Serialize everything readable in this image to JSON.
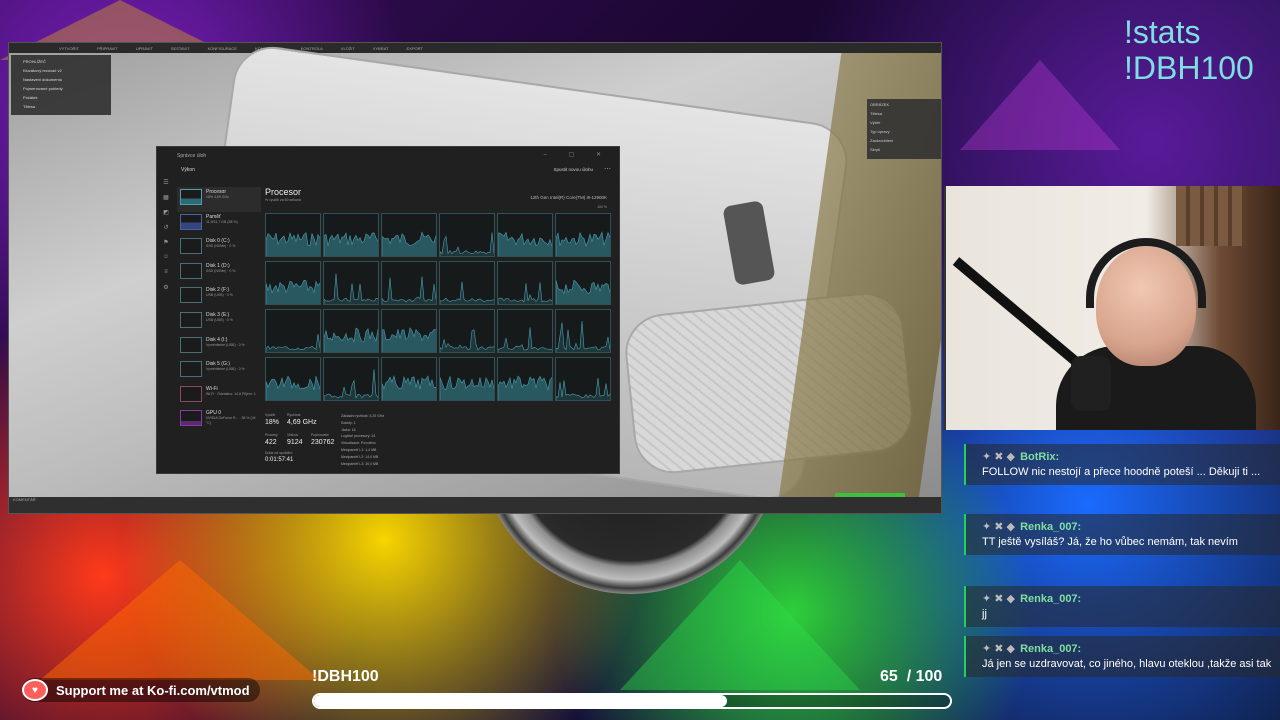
{
  "app": {
    "viewport_menu": [
      "VYTVOŘIT",
      "PŘIPRAVIT",
      "UPRAVIT",
      "SESTAVIT",
      "KONFIGURACE",
      "KONSTRUKCE",
      "KONTROLA",
      "VLOŽIT",
      "VYBRAT",
      "EXPORT"
    ],
    "viewport_tree": [
      "PROHLÍŽEČ",
      "Kluzákový rezovač v2",
      "Nastavení dokumentu",
      "Pojmenované pohledy",
      "Počátek",
      "Tělesa"
    ],
    "viewport_props": [
      "OBRÁZEK",
      "Tělesa",
      "Výběr",
      "Typ úpravy",
      "Zaokrouhlení",
      "Skrytí"
    ],
    "viewport_status": "KOMENTÁŘ"
  },
  "taskmgr": {
    "window_title": "Správce úloh",
    "window_buttons": "– ▢ ✕",
    "section": "Výkon",
    "new_task": "Spustit novou úlohu",
    "more": "⋯",
    "title": "Procesor",
    "cpu_name": "12th Gen Intel(R) Core(TM) i9-12900K",
    "subtitle": "% využití za 60 sekund",
    "max_pct": "100 %",
    "items": [
      {
        "name": "Procesor",
        "sub": "18%  4,69 GHz",
        "kind": "cpu"
      },
      {
        "name": "Paměť",
        "sub": "11,9/31,7 GB (38 %)",
        "kind": "mem"
      },
      {
        "name": "Disk 0 (C:)",
        "sub": "SSD (NVMe) · 0 %",
        "kind": "disk"
      },
      {
        "name": "Disk 1 (D:)",
        "sub": "SSD (NVMe) · 0 %",
        "kind": "disk"
      },
      {
        "name": "Disk 2 (F:)",
        "sub": "USB (USB) · 0 %",
        "kind": "disk"
      },
      {
        "name": "Disk 3 (E:)",
        "sub": "USB (USB) · 0 %",
        "kind": "disk"
      },
      {
        "name": "Disk 4 (I:)",
        "sub": "Vyměnitelné (USB) · 0 %",
        "kind": "disk"
      },
      {
        "name": "Disk 5 (G:)",
        "sub": "Vyměnitelné (USB) · 0 %",
        "kind": "disk"
      },
      {
        "name": "Wi-Fi",
        "sub": "Wi-Fi · Odesláno: 14,6 Přijem: 1",
        "kind": "wifi"
      },
      {
        "name": "GPU 0",
        "sub": "NVIDIA GeForce R... · 36 % (44 °C)",
        "kind": "gpu"
      }
    ],
    "stats": {
      "util_label": "Využití",
      "util": "18%",
      "speed_label": "Rychlost",
      "speed": "4,69 GHz",
      "proc_label": "Procesy",
      "proc": "422",
      "threads_label": "Vlákna",
      "threads": "9124",
      "handles_label": "Popisovače",
      "handles": "230762",
      "uptime_label": "Doba od spuštění",
      "uptime": "0:01:57:41",
      "right_lines": [
        "Základní rychlost:  3,20 GHz",
        "Sokety:  1",
        "Jádra:  16",
        "Logické procesory:  24",
        "Virtualizace:  Povoleno",
        "Mezipaměť L1:  1,4 MB",
        "Mezipaměť L2:  14,0 MB",
        "Mezipaměť L3:  30,0 MB"
      ]
    }
  },
  "stats_overlay": [
    "!stats",
    "!DBH100"
  ],
  "chat": [
    {
      "user": "BotRix:",
      "text": "FOLLOW nic nestojí a přece hoodně poteší ... Děkuji ti ..."
    },
    {
      "user": "Renka_007:",
      "text": "TT ještě vysíláš? Já, že ho vůbec nemám, tak nevím"
    },
    {
      "user": "Renka_007:",
      "text": "jj"
    },
    {
      "user": "Renka_007:",
      "text": "Já jen se uzdravovat, co jiného, hlavu oteklou ,takže asi tak"
    }
  ],
  "goal": {
    "label": "!DBH100",
    "current": "65",
    "total": "/ 100",
    "progress": 0.65
  },
  "kofi": {
    "text": "Support me at Ko-fi.com/vtmod"
  },
  "colors": {
    "accent": "#1fd35a",
    "stats": "#7fdfe0",
    "cpu_graph": "#4aa0b0"
  }
}
